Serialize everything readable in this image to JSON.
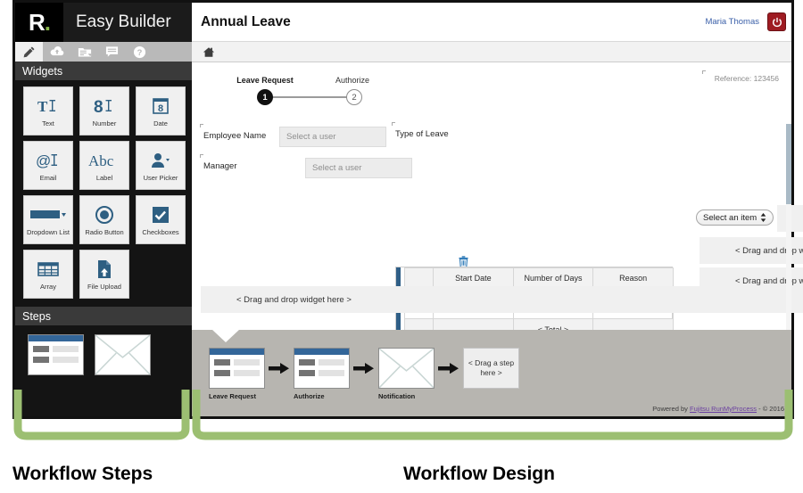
{
  "app": {
    "logo_text": "R",
    "logo_dot": ".",
    "brand_title": "Easy Builder"
  },
  "toolbar": {
    "icons": [
      {
        "name": "pencil-icon",
        "label": "Edit"
      },
      {
        "name": "cloud-upload-icon",
        "label": "Publish"
      },
      {
        "name": "folder-icon",
        "label": "Files"
      },
      {
        "name": "comment-icon",
        "label": "Comments"
      },
      {
        "name": "help-icon",
        "label": "Help"
      }
    ]
  },
  "sidebar": {
    "widgets_header": "Widgets",
    "steps_header": "Steps",
    "widgets": [
      {
        "label": "Text",
        "icon": "text-widget-icon"
      },
      {
        "label": "Number",
        "icon": "number-widget-icon"
      },
      {
        "label": "Date",
        "icon": "date-widget-icon"
      },
      {
        "label": "Email",
        "icon": "email-widget-icon"
      },
      {
        "label": "Label",
        "icon": "label-widget-icon"
      },
      {
        "label": "User Picker",
        "icon": "user-picker-widget-icon"
      },
      {
        "label": "Dropdown List",
        "icon": "dropdown-list-widget-icon"
      },
      {
        "label": "Radio Button",
        "icon": "radio-button-widget-icon"
      },
      {
        "label": "Checkboxes",
        "icon": "checkboxes-widget-icon"
      },
      {
        "label": "Array",
        "icon": "array-widget-icon"
      },
      {
        "label": "File Upload",
        "icon": "file-upload-widget-icon"
      }
    ],
    "steps": [
      {
        "name": "form-step-thumbnail",
        "type": "form"
      },
      {
        "name": "notification-step-thumbnail",
        "type": "notification"
      }
    ]
  },
  "header": {
    "page_title": "Annual Leave",
    "user_name": "Maria Thomas",
    "logout_icon": "power-icon",
    "home_icon": "home-icon"
  },
  "form": {
    "reference": "Reference: 123456",
    "step_indicator": {
      "steps": [
        {
          "number": "1",
          "label": "Leave Request",
          "state": "done"
        },
        {
          "number": "2",
          "label": "Authorize",
          "state": "pending"
        }
      ]
    },
    "fields": [
      {
        "label": "Employee Name",
        "placeholder": "Select a user"
      },
      {
        "label": "Manager",
        "placeholder": "Select a user"
      },
      {
        "label": "Type of Leave",
        "select_value": "Select an item"
      }
    ],
    "dropzone_text": "< Drag and drop widget here >",
    "array": {
      "columns": [
        "Start Date",
        "Number of Days",
        "Reason"
      ],
      "row_values": [
        "",
        "",
        ""
      ],
      "add_icon": "plus-icon",
      "remove_icon": "minus-icon",
      "delete_icon": "trash-icon",
      "total_label": "< Total >"
    }
  },
  "workflow": {
    "nodes": [
      {
        "label": "Leave Request",
        "type": "form"
      },
      {
        "label": "Authorize",
        "type": "form"
      },
      {
        "label": "Notification",
        "type": "notification"
      },
      {
        "label": "< Drag a step here >",
        "type": "placeholder"
      }
    ],
    "footer_prefix": "Powered by ",
    "footer_link": "Fujitsu RunMyProcess",
    "footer_suffix": " - © 2016"
  },
  "annotations": [
    {
      "label": "Workflow Steps"
    },
    {
      "label": "Workflow Design"
    }
  ],
  "colors": {
    "brand_green": "#8ab84a",
    "bracket_green": "#9cbf72",
    "widget_blue": "#2e5f82",
    "logout_red": "#9e1b22",
    "link_blue": "#3a5fa8"
  }
}
